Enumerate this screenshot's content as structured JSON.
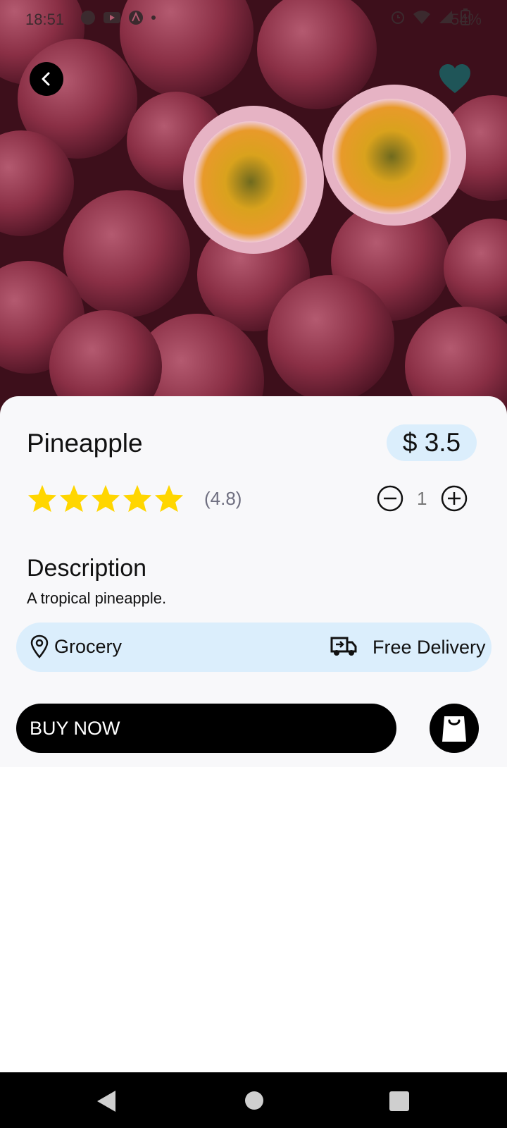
{
  "status_bar": {
    "time": "18:51",
    "battery": "54%"
  },
  "hero": {
    "image": "passion-fruit-photo"
  },
  "product": {
    "name": "Pineapple",
    "price": "$ 3.5",
    "rating_stars": 5,
    "rating_text": "(4.8)",
    "quantity": "1"
  },
  "description": {
    "title": "Description",
    "text": "A tropical pineapple."
  },
  "info": {
    "category": "Grocery",
    "delivery": "Free Delivery"
  },
  "actions": {
    "buy_now": "BUY NOW"
  },
  "colors": {
    "accent_pill": "#dbeefc",
    "star": "#ffd600",
    "favorite": "#1f5558",
    "button": "#000000"
  },
  "icons": [
    "back-icon",
    "heart-icon",
    "star-icon",
    "minus-circle-icon",
    "plus-circle-icon",
    "location-pin-icon",
    "truck-icon",
    "shopping-bag-icon"
  ]
}
